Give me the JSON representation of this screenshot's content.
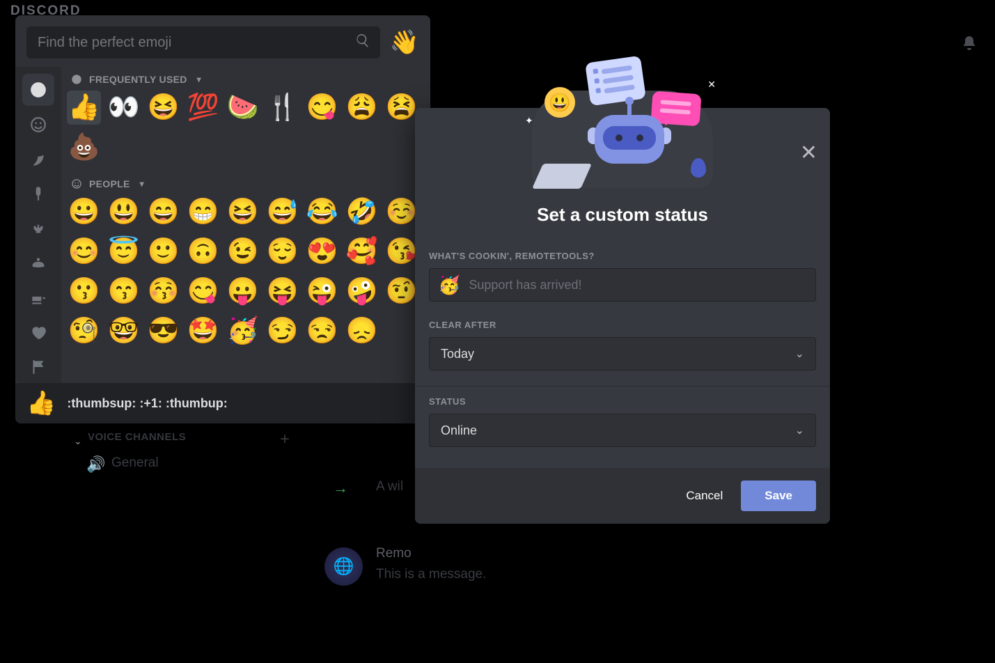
{
  "app": {
    "wordmark": "DISCORD"
  },
  "background": {
    "voice_channels_label": "VOICE CHANNELS",
    "channel_general": "General",
    "wild_text": "A wil",
    "msg_user": "Remo",
    "msg_text": "This is a message."
  },
  "emoji_picker": {
    "search_placeholder": "Find the perfect emoji",
    "skin_tone_emoji": "👋",
    "categories": [
      {
        "id": "recent",
        "label": "Frequently Used",
        "active": true
      },
      {
        "id": "custom",
        "label": "Custom"
      },
      {
        "id": "nature",
        "label": "Nature"
      },
      {
        "id": "food",
        "label": "Food"
      },
      {
        "id": "activity",
        "label": "Activities"
      },
      {
        "id": "travel",
        "label": "Travel"
      },
      {
        "id": "objects",
        "label": "Objects"
      },
      {
        "id": "symbols",
        "label": "Symbols"
      },
      {
        "id": "flags",
        "label": "Flags"
      }
    ],
    "sections": {
      "frequently_used": {
        "title": "FREQUENTLY USED",
        "emojis": [
          "👍",
          "👀",
          "😆",
          "💯",
          "🍉",
          "🍴",
          "😋",
          "😩",
          "😫",
          "💩"
        ]
      },
      "people": {
        "title": "PEOPLE",
        "emojis": [
          "😀",
          "😃",
          "😄",
          "😁",
          "😆",
          "😅",
          "😂",
          "🤣",
          "☺️",
          "😊",
          "😇",
          "🙂",
          "🙃",
          "😉",
          "😌",
          "😍",
          "🥰",
          "😘",
          "😗",
          "😙",
          "😚",
          "😋",
          "😛",
          "😝",
          "😜",
          "🤪",
          "🤨",
          "🧐",
          "🤓",
          "😎",
          "🤩",
          "🥳",
          "😏",
          "😒",
          "😞"
        ]
      }
    },
    "preview": {
      "emoji": "👍",
      "codes": ":thumbsup: :+1: :thumbup:"
    }
  },
  "status_modal": {
    "title": "Set a custom status",
    "field_label": "WHAT'S COOKIN', REMOTETOOLS?",
    "status_emoji": "🥳",
    "placeholder": "Support has arrived!",
    "clear_label": "CLEAR AFTER",
    "clear_value": "Today",
    "status_label": "STATUS",
    "status_value": "Online",
    "cancel": "Cancel",
    "save": "Save"
  }
}
